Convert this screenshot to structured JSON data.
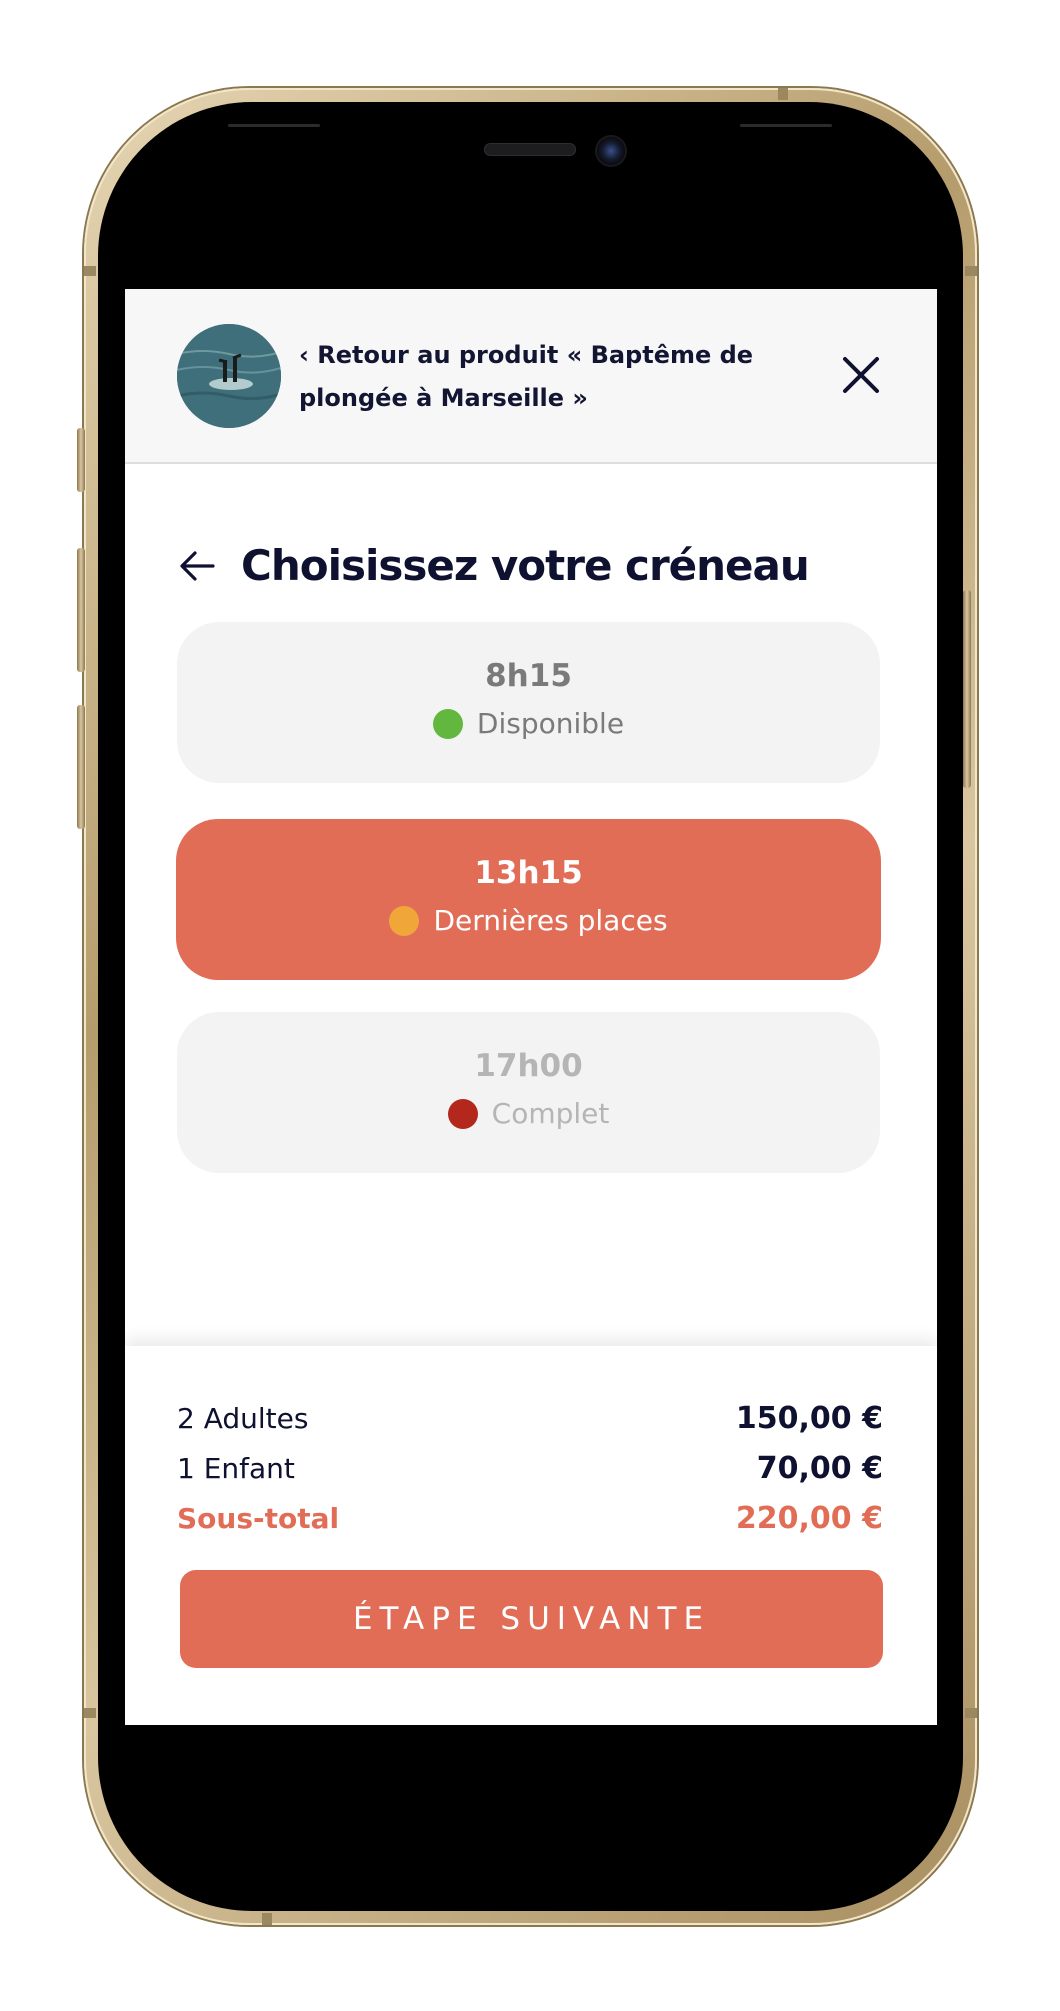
{
  "header": {
    "back_link_label": "‹ Retour au produit « Baptême de plongée à Marseille »",
    "avatar_icon": "diver-photo-icon",
    "close_icon": "close-icon"
  },
  "page": {
    "title": "Choisissez votre créneau",
    "back_icon": "arrow-left-icon"
  },
  "slots": [
    {
      "time": "8h15",
      "status": "Disponible",
      "dot_color": "#62b83e",
      "text_color": "#7a7a7a",
      "selected": false
    },
    {
      "time": "13h15",
      "status": "Dernières places",
      "dot_color": "#f1a63a",
      "text_color": "#ffffff",
      "selected": true
    },
    {
      "time": "17h00",
      "status": "Complet",
      "dot_color": "#b3271d",
      "text_color": "#b5b5b5",
      "selected": false
    }
  ],
  "summary": {
    "lines": [
      {
        "label": "2 Adultes",
        "value": "150,00 €"
      },
      {
        "label": "1 Enfant",
        "value": "70,00 €"
      }
    ],
    "subtotal": {
      "label": "Sous-total",
      "value": "220,00 €"
    }
  },
  "cta": {
    "label": "ÉTAPE SUIVANTE"
  },
  "colors": {
    "accent": "#e16d57",
    "text_dark": "#0e1130",
    "slot_bg": "#f3f3f3"
  }
}
